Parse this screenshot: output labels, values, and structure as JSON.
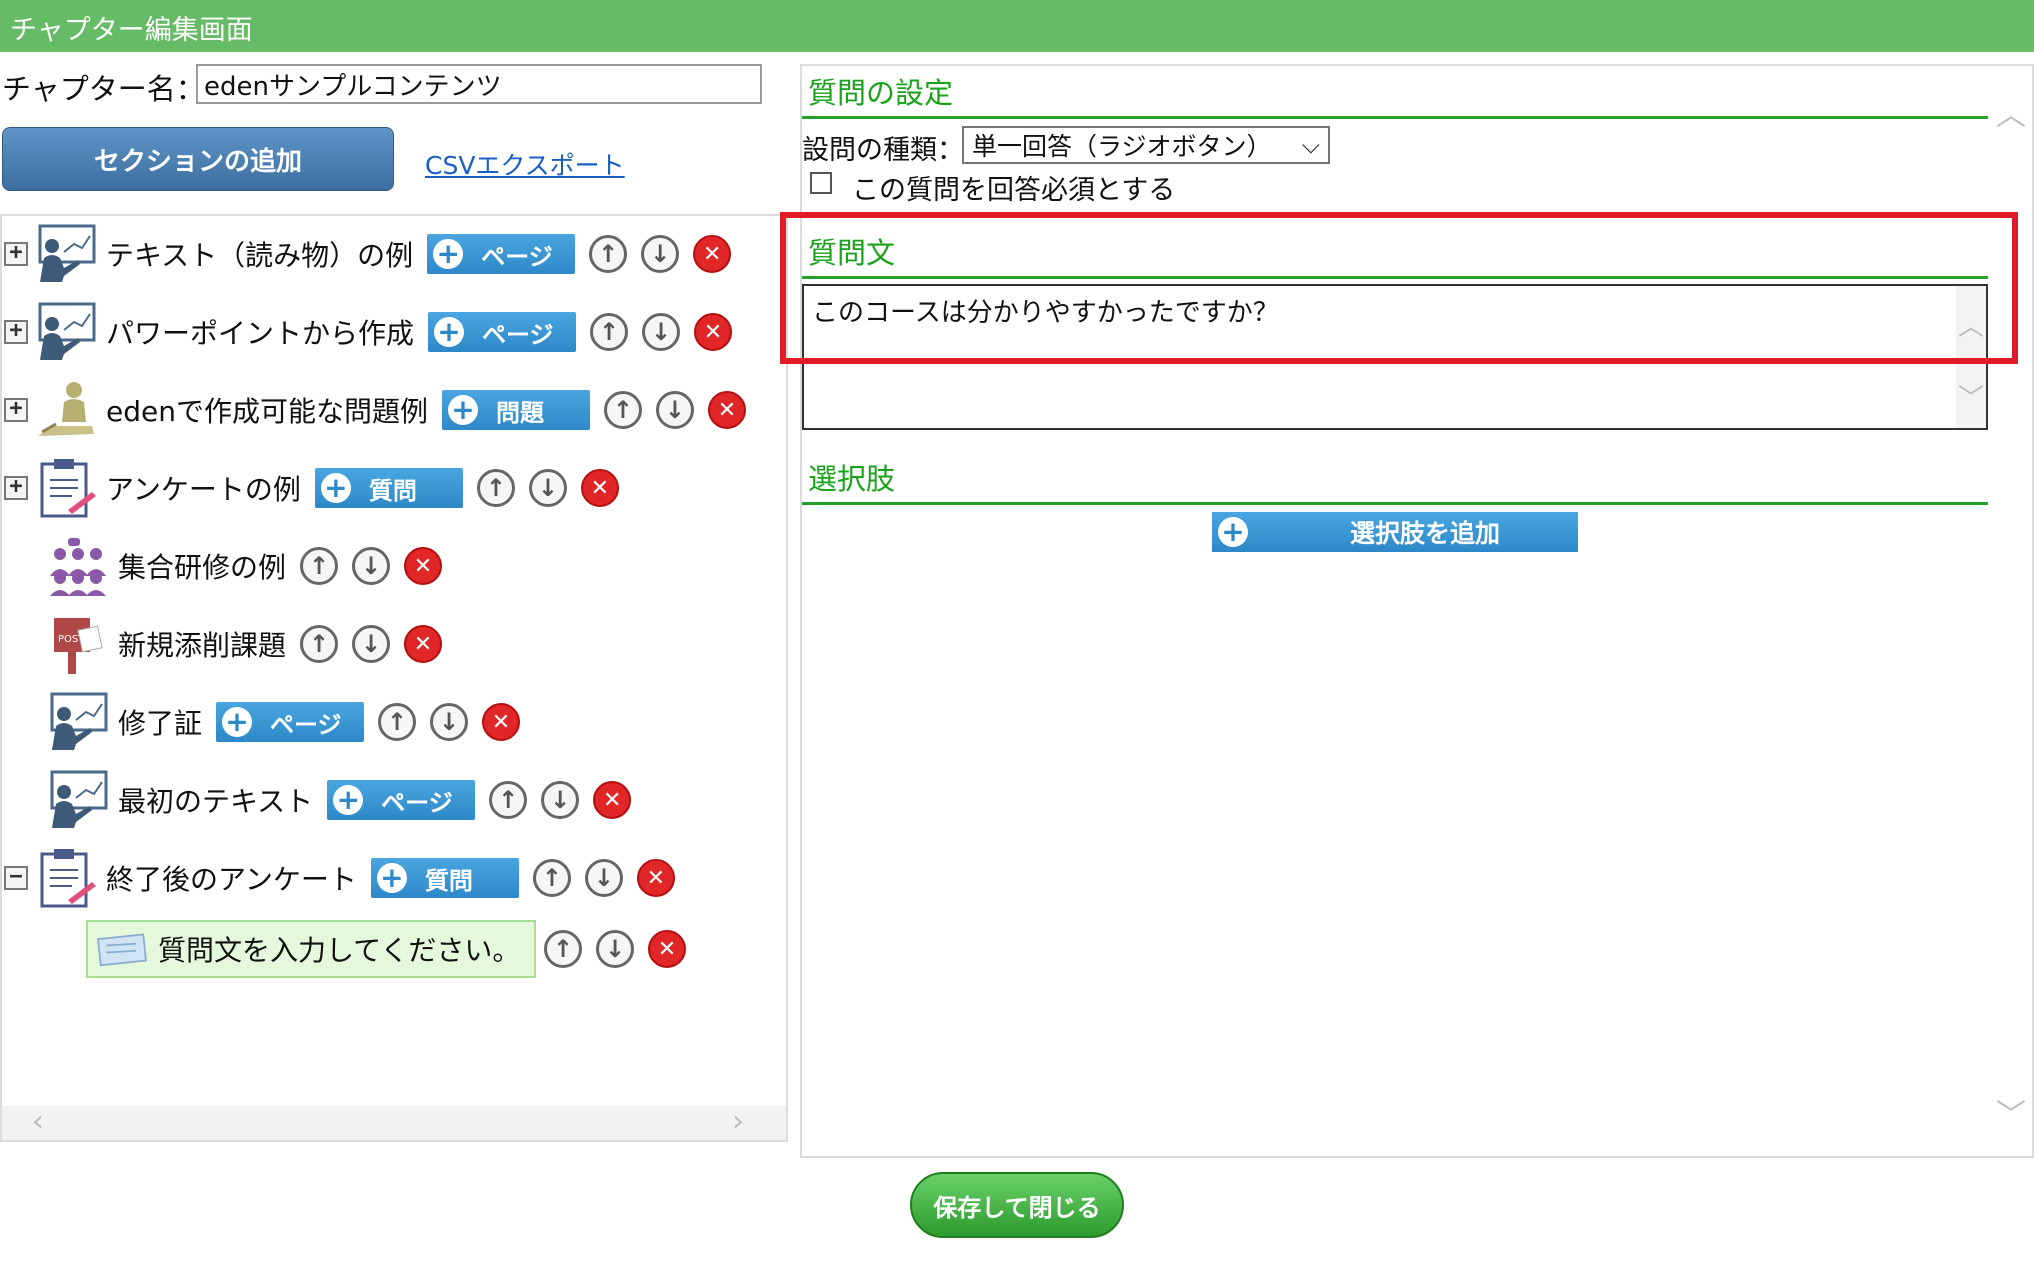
{
  "window": {
    "title": "チャプター編集画面"
  },
  "chapter": {
    "label": "チャプター名：",
    "value": "edenサンプルコンテンツ"
  },
  "toolbar": {
    "add_section": "セクションの追加",
    "csv_export": "CSVエクスポート"
  },
  "tree": {
    "items": [
      {
        "label": "テキスト（読み物）の例",
        "add_label": "ページ",
        "expander": "+",
        "icon": "teacher-icon"
      },
      {
        "label": "パワーポイントから作成",
        "add_label": "ページ",
        "expander": "+",
        "icon": "teacher-icon"
      },
      {
        "label": "edenで作成可能な問題例",
        "add_label": "問題",
        "expander": "+",
        "icon": "exam-icon"
      },
      {
        "label": "アンケートの例",
        "add_label": "質問",
        "expander": "+",
        "icon": "clipboard-icon"
      },
      {
        "label": "集合研修の例",
        "icon": "group-training-icon"
      },
      {
        "label": "新規添削課題",
        "icon": "post-box-icon"
      },
      {
        "label": "修了証",
        "add_label": "ページ",
        "icon": "teacher-icon"
      },
      {
        "label": "最初のテキスト",
        "add_label": "ページ",
        "icon": "teacher-icon"
      },
      {
        "label": "終了後のアンケート",
        "add_label": "質問",
        "expander": "−",
        "icon": "clipboard-icon"
      }
    ],
    "selected_child": {
      "label": "質問文を入力してください。",
      "icon": "question-card-icon"
    }
  },
  "right": {
    "settings_title": "質問の設定",
    "qtype_label": "設問の種類：",
    "qtype_value": "単一回答（ラジオボタン）",
    "required_label": "この質問を回答必須とする",
    "required_checked": false,
    "question_title": "質問文",
    "question_value": "このコースは分かりやすかったですか？",
    "choices_title": "選択肢",
    "add_choice": "選択肢を追加"
  },
  "footer": {
    "save_close": "保存して閉じる"
  },
  "colors": {
    "titlebar": "#66bb66",
    "section_green": "#1aa31a",
    "highlight_red": "#e21b2b",
    "button_blue": "#2d88c8"
  }
}
